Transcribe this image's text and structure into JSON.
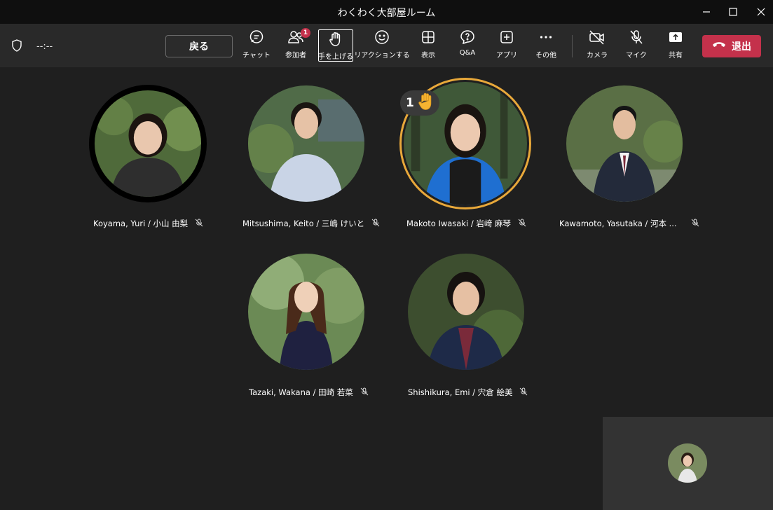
{
  "window": {
    "title": "わくわく大部屋ルーム"
  },
  "toolbar": {
    "timer": "--:--",
    "back_label": "戻る",
    "tools": [
      {
        "id": "chat",
        "label": "チャット",
        "icon": "chat-icon"
      },
      {
        "id": "participants",
        "label": "参加者",
        "icon": "people-icon",
        "badge": "1"
      },
      {
        "id": "raise-hand",
        "label": "手を上げる",
        "icon": "hand-icon"
      },
      {
        "id": "react",
        "label": "リアクションする",
        "icon": "smile-icon"
      },
      {
        "id": "view",
        "label": "表示",
        "icon": "grid-icon"
      },
      {
        "id": "qa",
        "label": "Q&A",
        "icon": "qa-icon"
      },
      {
        "id": "apps",
        "label": "アプリ",
        "icon": "plus-square-icon"
      },
      {
        "id": "more",
        "label": "その他",
        "icon": "more-icon"
      },
      {
        "id": "camera",
        "label": "カメラ",
        "icon": "camera-off-icon"
      },
      {
        "id": "mic",
        "label": "マイク",
        "icon": "mic-off-icon"
      },
      {
        "id": "share",
        "label": "共有",
        "icon": "share-icon"
      }
    ],
    "leave_label": "退出"
  },
  "participants": [
    {
      "name": "Koyama, Yuri / 小山 由梨",
      "muted": true,
      "bg": "#4f6a3a",
      "shirt": "#2e2e2e",
      "hair": "#1c1410"
    },
    {
      "name": "Mitsushima, Keito / 三嶋 けいと",
      "muted": true,
      "bg": "#506b48",
      "shirt": "#c9d4e6",
      "hair": "#1a1512"
    },
    {
      "name": "Makoto Iwasaki / 岩﨑 麻琴",
      "muted": true,
      "hand_raised": true,
      "hand_order": "1",
      "bg": "#3f5838",
      "shirt": "#1f6fd1",
      "hair": "#1a1410"
    },
    {
      "name": "Kawamoto, Yasutaka / 河本 ...",
      "muted": true,
      "bg": "#5a6f45",
      "shirt": "#232a3a",
      "hair": "#141414"
    },
    {
      "name": "Tazaki, Wakana / 田崎 若菜",
      "muted": true,
      "bg": "#6b8a55",
      "shirt": "#1f2140",
      "hair": "#4a2a1a"
    },
    {
      "name": "Shishikura, Emi / 宍倉 絵美",
      "muted": true,
      "bg": "#3d4e2f",
      "shirt": "#1e2a48",
      "hair": "#161210"
    }
  ],
  "self_view": {
    "bg": "#7a8b60",
    "shirt": "#e8e8e8",
    "hair": "#2a1c14"
  },
  "colors": {
    "leave": "#c4314b",
    "raised_hand_ring": "#e8a83a",
    "badge": "#c4314b"
  }
}
